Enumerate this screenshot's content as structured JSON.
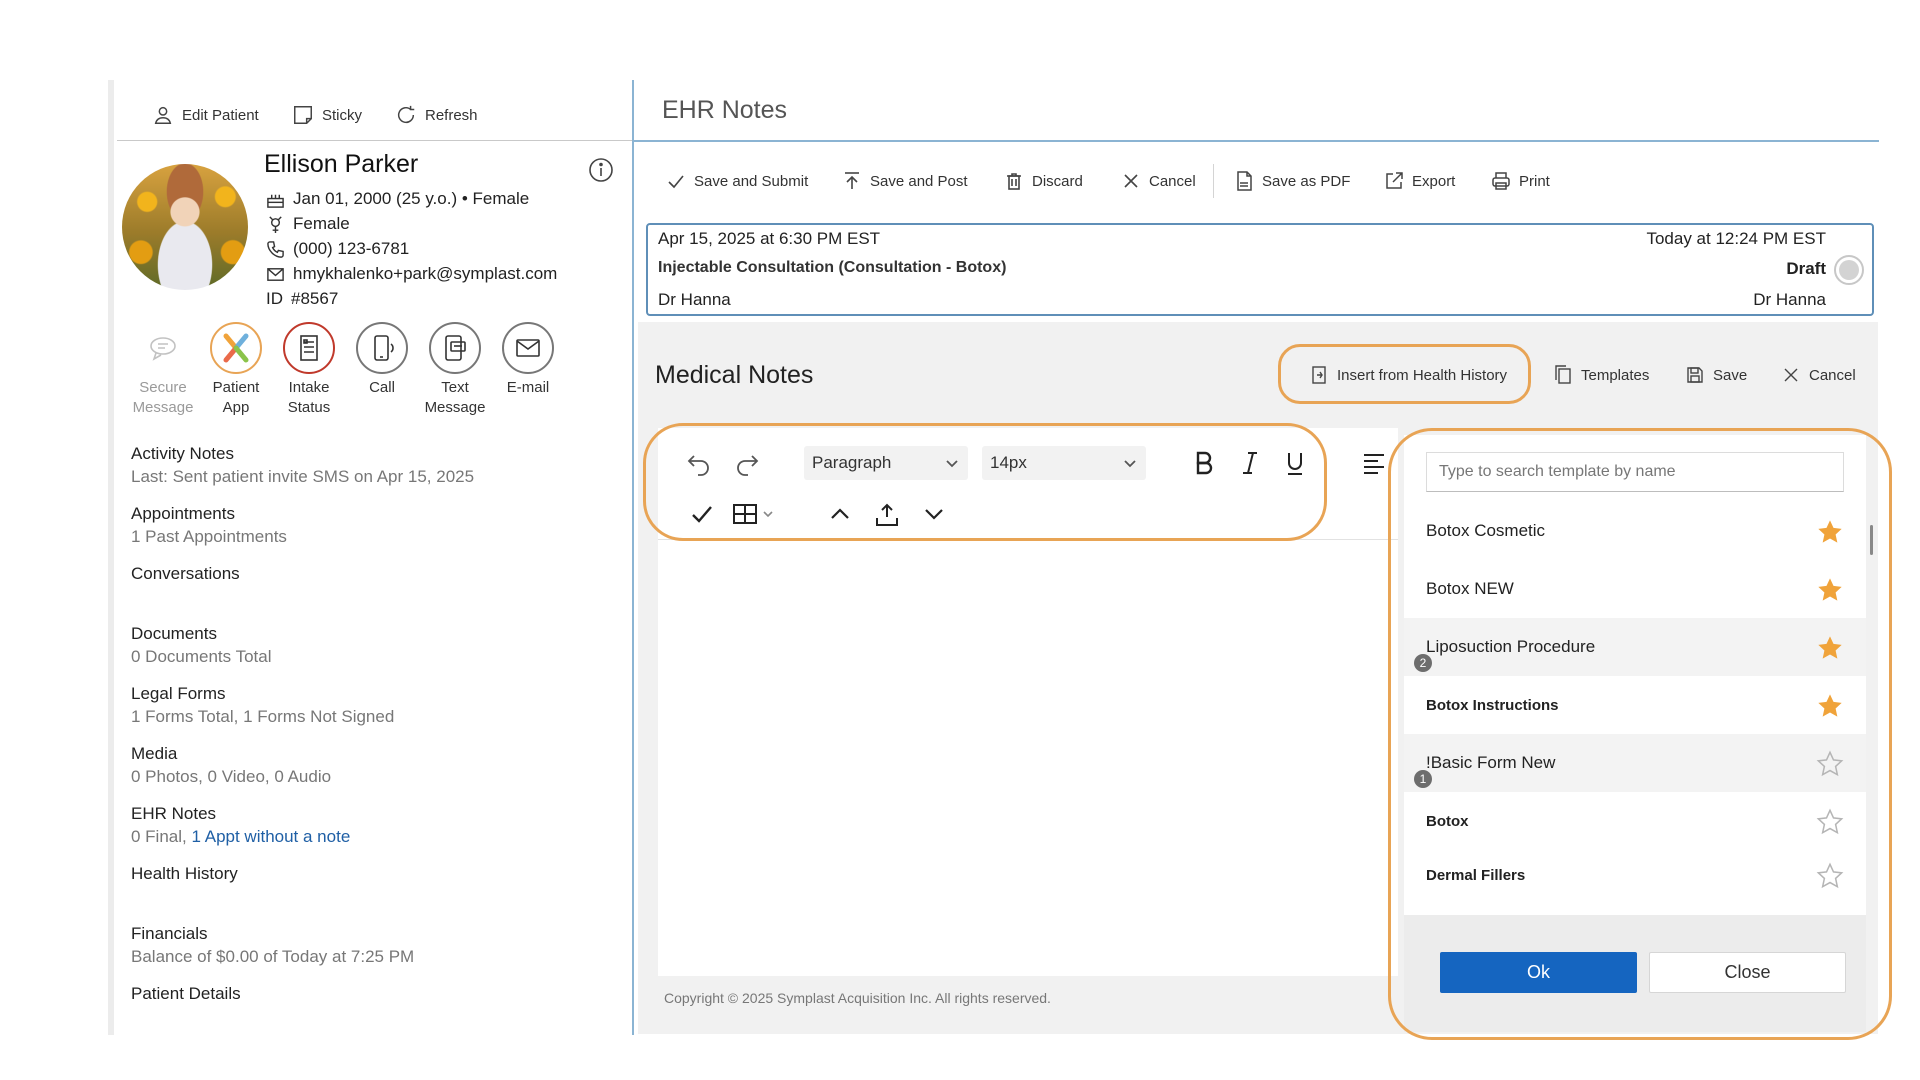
{
  "header": {
    "edit_patient": "Edit Patient",
    "sticky": "Sticky",
    "refresh": "Refresh"
  },
  "patient": {
    "name": "Ellison Parker",
    "dob": "Jan 01, 2000 (25 y.o.) • Female",
    "gender": "Female",
    "phone": "(000) 123-6781",
    "email": "hmykhalenko+park@symplast.com",
    "id_label": "ID",
    "id_value": "#8567"
  },
  "actions": [
    {
      "label": "Secure Message",
      "icon": "chat-bubble-icon",
      "enabled": false
    },
    {
      "label": "Patient App",
      "icon": "patient-app-icon",
      "enabled": true
    },
    {
      "label": "Intake Status",
      "icon": "intake-form-icon",
      "enabled": true
    },
    {
      "label": "Call",
      "icon": "phone-icon",
      "enabled": true
    },
    {
      "label": "Text Message",
      "icon": "sms-icon",
      "enabled": true
    },
    {
      "label": "E-mail",
      "icon": "envelope-icon",
      "enabled": true
    }
  ],
  "sections": {
    "activity": {
      "title": "Activity Notes",
      "sub": "Last: Sent patient invite SMS on Apr 15, 2025"
    },
    "appointments": {
      "title": "Appointments",
      "sub": "1 Past Appointments"
    },
    "conversations": {
      "title": "Conversations"
    },
    "documents": {
      "title": "Documents",
      "sub": "0 Documents Total"
    },
    "legal": {
      "title": "Legal Forms",
      "sub": "1 Forms Total, 1 Forms Not Signed"
    },
    "media": {
      "title": "Media",
      "sub": "0 Photos, 0 Video, 0 Audio"
    },
    "ehr": {
      "title": "EHR Notes",
      "sub_prefix": "0 Final,",
      "sub_link": "1 Appt without a note"
    },
    "health": {
      "title": "Health History"
    },
    "financials": {
      "title": "Financials",
      "sub": "Balance of $0.00 of Today at 7:25 PM"
    },
    "details": {
      "title": "Patient Details"
    }
  },
  "ehr": {
    "title": "EHR Notes",
    "toolbar": {
      "save_submit": "Save and Submit",
      "save_post": "Save and Post",
      "discard": "Discard",
      "cancel": "Cancel",
      "save_pdf": "Save as PDF",
      "export": "Export",
      "print": "Print"
    },
    "note": {
      "date": "Apr 15, 2025 at 6:30 PM EST",
      "type": "Injectable Consultation (Consultation - Botox)",
      "provider": "Dr Hanna",
      "updated": "Today at 12:24 PM EST",
      "status": "Draft",
      "author": "Dr Hanna"
    }
  },
  "medical_notes": {
    "title": "Medical Notes",
    "insert_health_history": "Insert from Health History",
    "templates": "Templates",
    "save": "Save",
    "cancel": "Cancel",
    "block_format": "Paragraph",
    "font_size": "14px"
  },
  "copyright": "Copyright © 2025 Symplast Acquisition Inc. All rights reserved.",
  "template_picker": {
    "search_placeholder": "Type to search template by name",
    "items": [
      {
        "name": "Botox Cosmetic",
        "favorite": true
      },
      {
        "name": "Botox NEW",
        "favorite": true
      },
      {
        "name": "Liposuction Procedure",
        "favorite": true,
        "badge": "2"
      },
      {
        "name": "Botox Instructions",
        "favorite": true
      },
      {
        "name": "!Basic Form New",
        "favorite": false,
        "badge": "1"
      },
      {
        "name": "Botox",
        "favorite": false
      },
      {
        "name": "Dermal Fillers",
        "favorite": false
      }
    ],
    "ok": "Ok",
    "close": "Close"
  },
  "colors": {
    "accent_blue": "#1565c0",
    "divider_blue": "#8bb4d3",
    "highlight_orange": "#e8a455",
    "star_gold": "#f0a33a"
  }
}
